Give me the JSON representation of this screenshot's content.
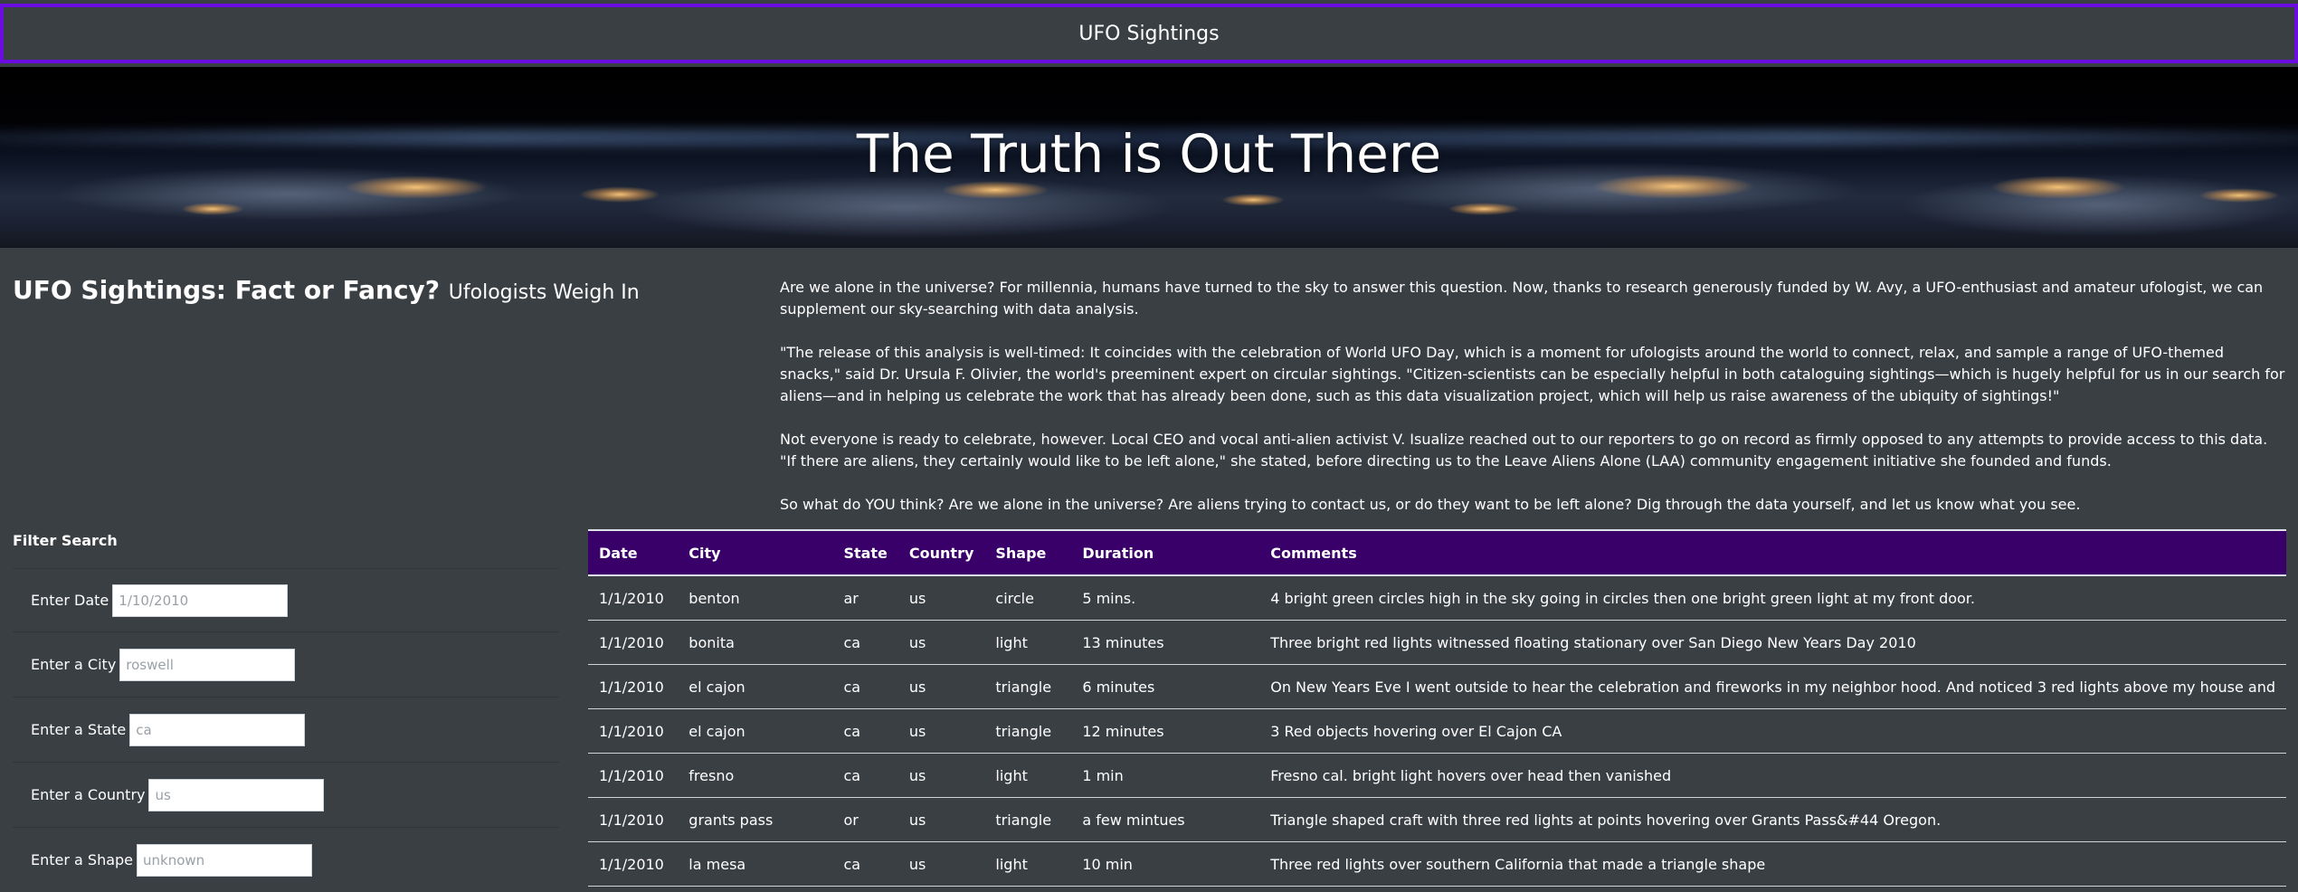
{
  "navbar": {
    "brand": "UFO Sightings"
  },
  "hero": {
    "title": "The Truth is Out There"
  },
  "intro": {
    "heading": "UFO Sightings: Fact or Fancy?",
    "subheading": "Ufologists Weigh In",
    "paragraphs": [
      "Are we alone in the universe? For millennia, humans have turned to the sky to answer this question. Now, thanks to research generously funded by W. Avy, a UFO-enthusiast and amateur ufologist, we can supplement our sky-searching with data analysis.",
      "\"The release of this analysis is well-timed: It coincides with the celebration of World UFO Day, which is a moment for ufologists around the world to connect, relax, and sample a range of UFO-themed snacks,\" said Dr. Ursula F. Olivier, the world's preeminent expert on circular sightings. \"Citizen-scientists can be especially helpful in both cataloguing sightings—which is hugely helpful for us in our search for aliens—and in helping us celebrate the work that has already been done, such as this data visualization project, which will help us raise awareness of the ubiquity of sightings!\"",
      "Not everyone is ready to celebrate, however. Local CEO and vocal anti-alien activist V. Isualize reached out to our reporters to go on record as firmly opposed to any attempts to provide access to this data. \"If there are aliens, they certainly would like to be left alone,\" she stated, before directing us to the Leave Aliens Alone (LAA) community engagement initiative she founded and funds.",
      "So what do YOU think? Are we alone in the universe? Are aliens trying to contact us, or do they want to be left alone? Dig through the data yourself, and let us know what you see."
    ]
  },
  "filters": {
    "title": "Filter Search",
    "date": {
      "label": "Enter Date",
      "placeholder": "1/10/2010"
    },
    "city": {
      "label": "Enter a City",
      "placeholder": "roswell"
    },
    "state": {
      "label": "Enter a State",
      "placeholder": "ca"
    },
    "country": {
      "label": "Enter a Country",
      "placeholder": "us"
    },
    "shape": {
      "label": "Enter a Shape",
      "placeholder": "unknown"
    }
  },
  "table": {
    "headers": [
      "Date",
      "City",
      "State",
      "Country",
      "Shape",
      "Duration",
      "Comments"
    ],
    "rows": [
      [
        "1/1/2010",
        "benton",
        "ar",
        "us",
        "circle",
        "5 mins.",
        "4 bright green circles high in the sky going in circles then one bright green light at my front door."
      ],
      [
        "1/1/2010",
        "bonita",
        "ca",
        "us",
        "light",
        "13 minutes",
        "Three bright red lights witnessed floating stationary over San Diego New Years Day 2010"
      ],
      [
        "1/1/2010",
        "el cajon",
        "ca",
        "us",
        "triangle",
        "6 minutes",
        "On New Years Eve I went outside to hear the celebration and fireworks in my neighbor hood. And noticed 3 red lights above my house and"
      ],
      [
        "1/1/2010",
        "el cajon",
        "ca",
        "us",
        "triangle",
        "12 minutes",
        "3 Red objects hovering over El Cajon CA"
      ],
      [
        "1/1/2010",
        "fresno",
        "ca",
        "us",
        "light",
        "1 min",
        "Fresno cal. bright light hovers over head then vanished"
      ],
      [
        "1/1/2010",
        "grants pass",
        "or",
        "us",
        "triangle",
        "a few mintues",
        "Triangle shaped craft with three red lights at points hovering over Grants Pass&#44 Oregon."
      ],
      [
        "1/1/2010",
        "la mesa",
        "ca",
        "us",
        "light",
        "10 min",
        "Three red lights over southern California that made a triangle shape"
      ]
    ]
  },
  "colors": {
    "background": "#3a3f44",
    "navbar_border": "#6a0dde",
    "table_header": "#3a006a"
  }
}
